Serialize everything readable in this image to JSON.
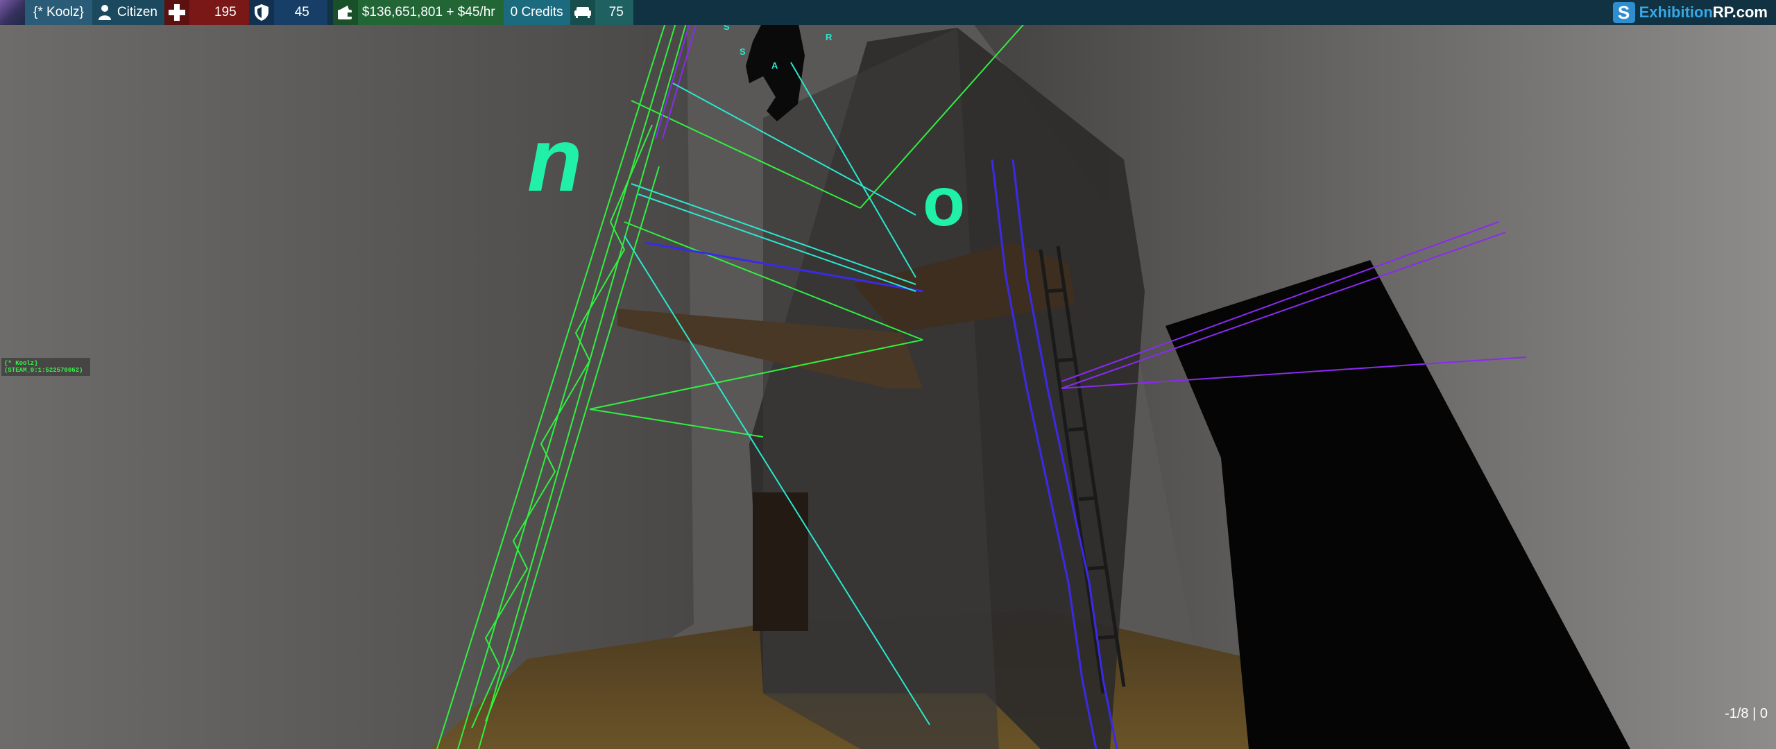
{
  "hud": {
    "player_name": "{* Koolz}",
    "job": "Citizen",
    "health": "195",
    "armor": "45",
    "money": "$136,651,801 + $45/hr",
    "credits": "0 Credits",
    "props": "75",
    "brand_name": "Exhibition",
    "brand_suffix": "RP.com",
    "colors": {
      "bar": "#113242",
      "health": "#7a1818",
      "armor": "#173e66",
      "money": "#226636",
      "credits": "#1b6a7e",
      "brand": "#36a8e8"
    },
    "icons": [
      "avatar",
      "person-icon",
      "health-cross-icon",
      "shield-icon",
      "wallet-icon",
      "couch-icon",
      "brand-logo-icon"
    ]
  },
  "world": {
    "letter_n": "n",
    "letter_o": "o",
    "fragment_1": "S",
    "fragment_2": "R",
    "fragment_3": "S",
    "fragment_4": "A",
    "accent_color": "#20f0a8"
  },
  "nametag": {
    "line1": "{* Koolz}",
    "line2": "(STEAM_0:1:522570062)"
  },
  "ammo": "-1/8 | 0"
}
